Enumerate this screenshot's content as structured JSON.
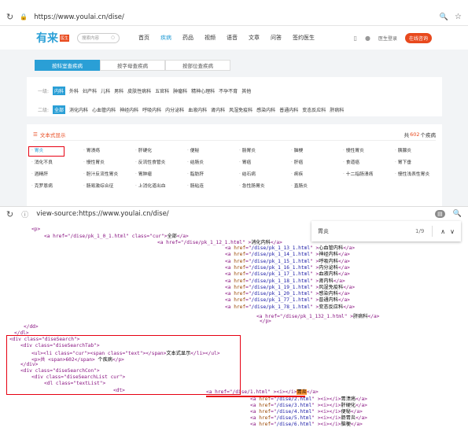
{
  "browser1": {
    "url": "https://www.youlai.cn/dise/"
  },
  "site": {
    "logo": "有来",
    "logo_badge": "医生",
    "search_placeholder": "搜索内容",
    "nav": [
      "首页",
      "疾病",
      "药品",
      "视频",
      "语音",
      "文章",
      "问答",
      "签约医生"
    ],
    "login": "医生登录",
    "consult": "在线咨询"
  },
  "tabs": [
    "按科室查疾病",
    "按字母查疾病",
    "按部位查疾病"
  ],
  "level1": {
    "label": "一级:",
    "items": [
      "内科",
      "外科",
      "妇产科",
      "儿科",
      "男科",
      "皮肤性病科",
      "五官科",
      "肿瘤科",
      "精神心理科",
      "不孕不育",
      "其他"
    ]
  },
  "level2": {
    "label": "二级:",
    "items": [
      "全部",
      "消化内科",
      "心血管内科",
      "神经内科",
      "呼吸内科",
      "内分泌科",
      "血液内科",
      "肾内科",
      "风湿免疫科",
      "感染内科",
      "普通内科",
      "变态反应科",
      "肝病科"
    ]
  },
  "list": {
    "title": "文本式显示",
    "count_prefix": "共",
    "count": "602",
    "count_suffix": "个疾病"
  },
  "diseases": [
    [
      "胃炎",
      "胃溃疡",
      "肝硬化",
      "便秘",
      "肠胃炎",
      "脑梗",
      "慢性胃炎",
      "胰腺炎"
    ],
    [
      "消化不良",
      "慢性胃炎",
      "反流性食管炎",
      "结肠炎",
      "胃癌",
      "肝癌",
      "食道癌",
      "胃下垂"
    ],
    [
      "酒精肝",
      "胆汁反流性胃炎",
      "胃肿瘤",
      "脂肪肝",
      "结石病",
      "痢疾",
      "十二指肠溃疡",
      "慢性浅表性胃炎"
    ],
    [
      "克罗恩病",
      "肠易激综合征",
      "上消化道出血",
      "肠粘连",
      "急性肠胃炎",
      "直肠炎"
    ]
  ],
  "browser2": {
    "url": "view-source:https://www.youlai.cn/dise/"
  },
  "find": {
    "query": "胃炎",
    "count": "1/9"
  },
  "src": {
    "l1": "<p>",
    "l2a": "<a href=\"/dise/pk_1_0_1.html\" class=\"cur\">",
    "l2b": "全部",
    "l2c": "</a>",
    "l3a": "<a href=\"/dise/pk_1_12_1.html\" >",
    "l3b": "消化内科",
    "l3c": "</a>",
    "sub": [
      [
        "/dise/pk_1_13_1.html",
        "心血管内科"
      ],
      [
        "/dise/pk_1_14_1.html",
        "神经内科"
      ],
      [
        "/dise/pk_1_15_1.html",
        "呼吸内科"
      ],
      [
        "/dise/pk_1_16_1.html",
        "内分泌科"
      ],
      [
        "/dise/pk_1_17_1.html",
        "血液内科"
      ],
      [
        "/dise/pk_1_18_1.html",
        "肾内科"
      ],
      [
        "/dise/pk_1_19_1.html",
        "风湿免疫科"
      ],
      [
        "/dise/pk_1_20_1.html",
        "感染内科"
      ],
      [
        "/dise/pk_1_77_1.html",
        "普通内科"
      ],
      [
        "/dise/pk_1_78_1.html",
        "变态反应科"
      ]
    ],
    "l14a": "<a href=\"/dise/pk_1_132_1.html\" >",
    "l14b": "肝病科",
    "l14c": "</a>",
    "l15": "</p>",
    "l16": "</dd>",
    "l17": "</dl>",
    "b1": "<div class=\"diseSearch\">",
    "b2": "<div class=\"diseSearchTab\">",
    "b3a": "<ul><li class=\"cur\"><span class=\"text\"></span>",
    "b3b": "文本式显示",
    "b3c": "</li></ul>",
    "b4a": "<p>共 <span>602</span>",
    "b4b": " 个疾病",
    "b4c": "</p>",
    "b5": "</div>",
    "b6": "<div class=\"diseSearchCon\">",
    "b7": "<div class=\"diseSearchList cur\">",
    "b8": "<dl class=\"textList\">",
    "b9": "<dt>",
    "h1a": "<a href=\"/dise/1.html\" ><i></i>",
    "h1b": "胃炎",
    "h1c": "</a>",
    "more": [
      [
        "/dise/2.html",
        "胃溃疡"
      ],
      [
        "/dise/3.html",
        "肝硬化"
      ],
      [
        "/dise/4.html",
        "便秘"
      ],
      [
        "/dise/5.html",
        "肠胃炎"
      ],
      [
        "/dise/6.html",
        "脑梗"
      ]
    ]
  },
  "colors": {
    "brand": "#2a9fd6",
    "accent": "#e8491d",
    "highlight": "#ff9632",
    "red_box": "#e60012"
  }
}
